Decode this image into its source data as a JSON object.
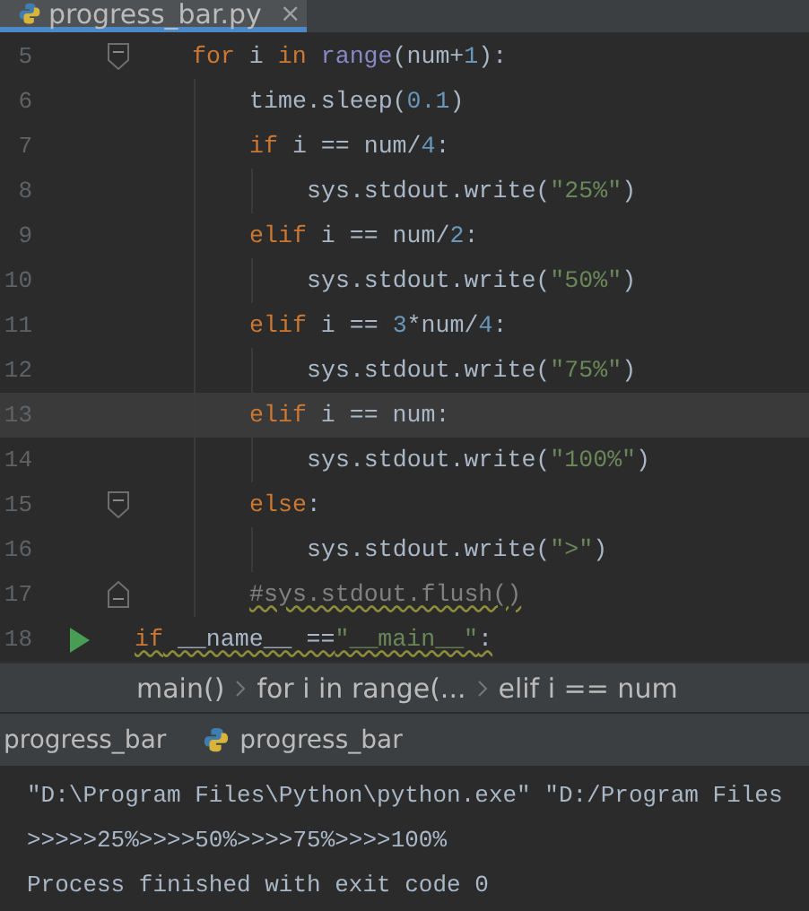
{
  "editor_tab": {
    "title": "progress_bar.py",
    "close": "×"
  },
  "code_lines": [
    {
      "number": "5",
      "kind": "fold-start",
      "current": false,
      "warning": false,
      "tokens": [
        {
          "kind": "keyword",
          "text": "    for"
        },
        {
          "kind": "plain",
          "text": " i "
        },
        {
          "kind": "keyword",
          "text": "in "
        },
        {
          "kind": "builtin",
          "text": "range"
        },
        {
          "kind": "plain",
          "text": "(num+"
        },
        {
          "kind": "number",
          "text": "1"
        },
        {
          "kind": "plain",
          "text": "):"
        }
      ]
    },
    {
      "number": "6",
      "kind": "code",
      "current": false,
      "warning": false,
      "tokens": [
        {
          "kind": "plain",
          "text": "        time.sleep("
        },
        {
          "kind": "number",
          "text": "0.1"
        },
        {
          "kind": "plain",
          "text": ")"
        }
      ]
    },
    {
      "number": "7",
      "kind": "code",
      "current": false,
      "warning": false,
      "tokens": [
        {
          "kind": "keyword",
          "text": "        if"
        },
        {
          "kind": "plain",
          "text": " i == num/"
        },
        {
          "kind": "number",
          "text": "4"
        },
        {
          "kind": "plain",
          "text": ":"
        }
      ]
    },
    {
      "number": "8",
      "kind": "code",
      "current": false,
      "warning": false,
      "tokens": [
        {
          "kind": "plain",
          "text": "            sys.stdout.write("
        },
        {
          "kind": "string",
          "text": "\"25%\""
        },
        {
          "kind": "plain",
          "text": ")"
        }
      ]
    },
    {
      "number": "9",
      "kind": "code",
      "current": false,
      "warning": false,
      "tokens": [
        {
          "kind": "keyword",
          "text": "        elif"
        },
        {
          "kind": "plain",
          "text": " i == num/"
        },
        {
          "kind": "number",
          "text": "2"
        },
        {
          "kind": "plain",
          "text": ":"
        }
      ]
    },
    {
      "number": "10",
      "kind": "code",
      "current": false,
      "warning": false,
      "tokens": [
        {
          "kind": "plain",
          "text": "            sys.stdout.write("
        },
        {
          "kind": "string",
          "text": "\"50%\""
        },
        {
          "kind": "plain",
          "text": ")"
        }
      ]
    },
    {
      "number": "11",
      "kind": "code",
      "current": false,
      "warning": false,
      "tokens": [
        {
          "kind": "keyword",
          "text": "        elif"
        },
        {
          "kind": "plain",
          "text": " i == "
        },
        {
          "kind": "number",
          "text": "3"
        },
        {
          "kind": "plain",
          "text": "*num/"
        },
        {
          "kind": "number",
          "text": "4"
        },
        {
          "kind": "plain",
          "text": ":"
        }
      ]
    },
    {
      "number": "12",
      "kind": "code",
      "current": false,
      "warning": false,
      "tokens": [
        {
          "kind": "plain",
          "text": "            sys.stdout.write("
        },
        {
          "kind": "string",
          "text": "\"75%\""
        },
        {
          "kind": "plain",
          "text": ")"
        }
      ]
    },
    {
      "number": "13",
      "kind": "code",
      "current": true,
      "warning": false,
      "tokens": [
        {
          "kind": "keyword",
          "text": "        elif"
        },
        {
          "kind": "plain",
          "text": " i == num:"
        }
      ]
    },
    {
      "number": "14",
      "kind": "code",
      "current": false,
      "warning": false,
      "tokens": [
        {
          "kind": "plain",
          "text": "            sys.stdout.write("
        },
        {
          "kind": "string",
          "text": "\"100%\""
        },
        {
          "kind": "plain",
          "text": ")"
        }
      ]
    },
    {
      "number": "15",
      "kind": "fold-start",
      "current": false,
      "warning": false,
      "tokens": [
        {
          "kind": "keyword",
          "text": "        else"
        },
        {
          "kind": "plain",
          "text": ":"
        }
      ]
    },
    {
      "number": "16",
      "kind": "code",
      "current": false,
      "warning": false,
      "tokens": [
        {
          "kind": "plain",
          "text": "            sys.stdout.write("
        },
        {
          "kind": "string",
          "text": "\">\""
        },
        {
          "kind": "plain",
          "text": ")"
        }
      ]
    },
    {
      "number": "17",
      "kind": "fold-end",
      "current": false,
      "warning": true,
      "tokens": [
        {
          "kind": "comment",
          "text": "        #sys.stdout.flush()"
        }
      ]
    },
    {
      "number": "18",
      "kind": "run",
      "current": false,
      "warning": true,
      "tokens": [
        {
          "kind": "keyword",
          "text": "if"
        },
        {
          "kind": "plain",
          "text": " __name__ =="
        },
        {
          "kind": "string",
          "text": "\"__main__\""
        },
        {
          "kind": "plain",
          "text": ":"
        }
      ]
    }
  ],
  "breadcrumbs": [
    "main()",
    "for i in range(...",
    "elif i == num"
  ],
  "run_tabs": [
    {
      "label": "progress_bar",
      "icon": false
    },
    {
      "label": "progress_bar",
      "icon": true
    }
  ],
  "console_lines": [
    "\"D:\\Program Files\\Python\\python.exe\" \"D:/Program Files",
    ">>>>>25%>>>>50%>>>>75%>>>>100%",
    "Process finished with exit code 0"
  ]
}
